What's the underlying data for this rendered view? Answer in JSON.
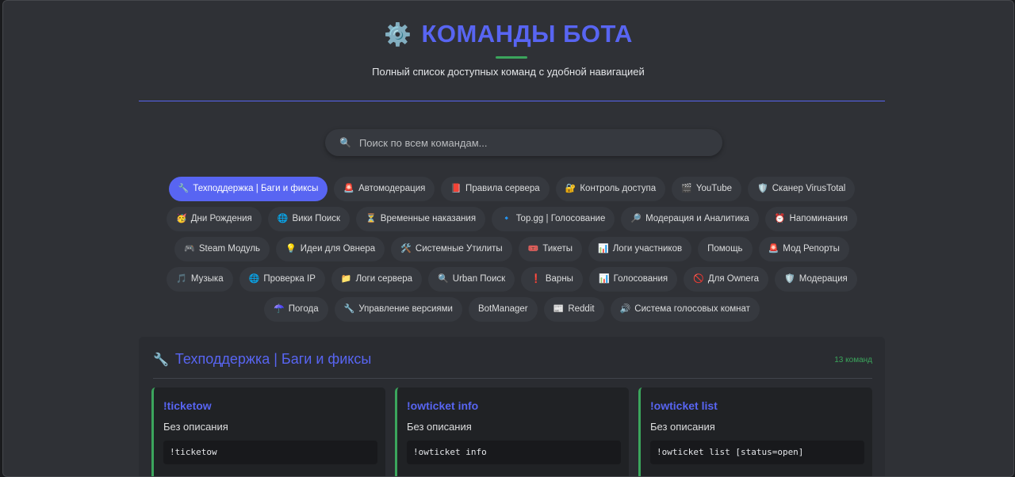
{
  "header": {
    "title_icon": "⚙️",
    "title": "КОМАНДЫ БОТА",
    "subtitle": "Полный список доступных команд с удобной навигацией"
  },
  "search": {
    "icon": "🔍",
    "placeholder": "Поиск по всем командам..."
  },
  "categories": [
    {
      "icon": "🔧",
      "label": "Техподдержка | Баги и фиксы",
      "active": true
    },
    {
      "icon": "🚨",
      "label": "Автомодерация"
    },
    {
      "icon": "📕",
      "label": "Правила сервера"
    },
    {
      "icon": "🔐",
      "label": "Контроль доступа"
    },
    {
      "icon": "🎬",
      "label": "YouTube"
    },
    {
      "icon": "🛡️",
      "label": "Сканер VirusTotal"
    },
    {
      "icon": "🥳",
      "label": "Дни Рождения"
    },
    {
      "icon": "🌐",
      "label": "Вики Поиск"
    },
    {
      "icon": "⏳",
      "label": "Временные наказания"
    },
    {
      "icon": "🔹",
      "label": "Top.gg | Голосование"
    },
    {
      "icon": "🔎",
      "label": "Модерация и Аналитика"
    },
    {
      "icon": "⏰",
      "label": "Напоминания"
    },
    {
      "icon": "🎮",
      "label": "Steam Модуль"
    },
    {
      "icon": "💡",
      "label": "Идеи для Овнера"
    },
    {
      "icon": "🛠️",
      "label": "Системные Утилиты"
    },
    {
      "icon": "🎟️",
      "label": "Тикеты"
    },
    {
      "icon": "📊",
      "label": "Логи участников"
    },
    {
      "icon": "",
      "label": "Помощь"
    },
    {
      "icon": "🚨",
      "label": "Мод Репорты"
    },
    {
      "icon": "🎵",
      "label": "Музыка"
    },
    {
      "icon": "🌐",
      "label": "Проверка IP"
    },
    {
      "icon": "📁",
      "label": "Логи сервера"
    },
    {
      "icon": "🔍",
      "label": "Urban Поиск"
    },
    {
      "icon": "❗",
      "label": "Варны"
    },
    {
      "icon": "📊",
      "label": "Голосования"
    },
    {
      "icon": "🚫",
      "label": "Для Ownera"
    },
    {
      "icon": "🛡️",
      "label": "Модерация"
    },
    {
      "icon": "☂️",
      "label": "Погода"
    },
    {
      "icon": "🔧",
      "label": "Управление версиями"
    },
    {
      "icon": "",
      "label": "BotManager"
    },
    {
      "icon": "📰",
      "label": "Reddit"
    },
    {
      "icon": "🔊",
      "label": "Система голосовых комнат"
    }
  ],
  "section": {
    "icon": "🔧",
    "title": "Техподдержка | Баги и фиксы",
    "count": "13 команд",
    "commands": [
      {
        "name": "!ticketow",
        "description": "Без описания",
        "usage": "!ticketow"
      },
      {
        "name": "!owticket info",
        "description": "Без описания",
        "usage": "!owticket info"
      },
      {
        "name": "!owticket list",
        "description": "Без описания",
        "usage": "!owticket list [status=open]"
      }
    ]
  },
  "colors": {
    "accent": "#5865f2",
    "success": "#3ba55c",
    "background": "#2f3136"
  }
}
